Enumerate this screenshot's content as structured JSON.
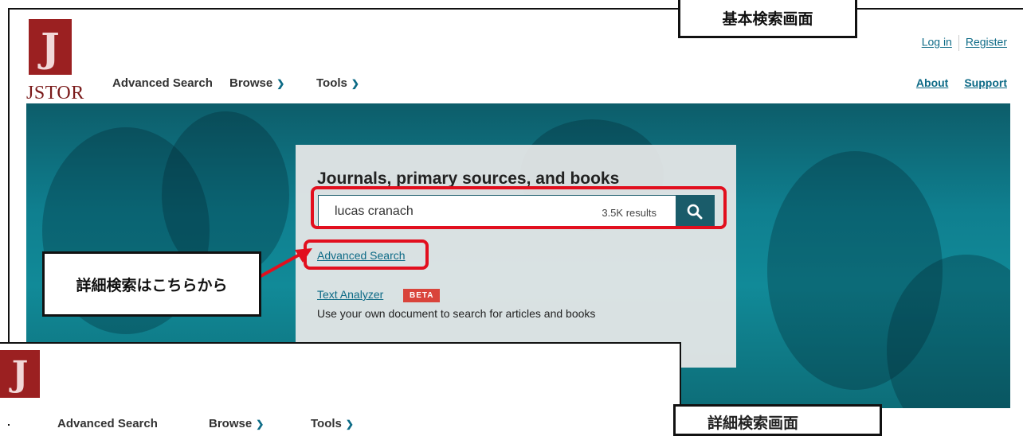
{
  "header": {
    "logo_text": "JSTOR",
    "nav": [
      {
        "label": "Advanced Search"
      },
      {
        "label": "Browse"
      },
      {
        "label": "Tools"
      }
    ],
    "login": "Log in",
    "register": "Register",
    "about": "About",
    "support": "Support"
  },
  "search": {
    "title": "Journals, primary sources, and books",
    "query": "lucas cranach",
    "results": "3.5K results",
    "advanced_link": "Advanced Search",
    "text_analyzer": "Text Analyzer",
    "beta": "BETA",
    "text_analyzer_desc": "Use your own document to search for articles and books"
  },
  "annotations": {
    "basic_label": "基本検索画面",
    "advanced_label": "詳細検索はこちらから",
    "bottom_label": "詳細検索画面"
  },
  "lower_screenshot": {
    "nav": [
      {
        "label": "Advanced Search"
      },
      {
        "label": "Browse"
      },
      {
        "label": "Tools"
      }
    ]
  },
  "colors": {
    "brand_red": "#9b2021",
    "link_teal": "#0d6a86",
    "annotation_red": "#e20f1e",
    "search_button": "#1a5c6a"
  }
}
